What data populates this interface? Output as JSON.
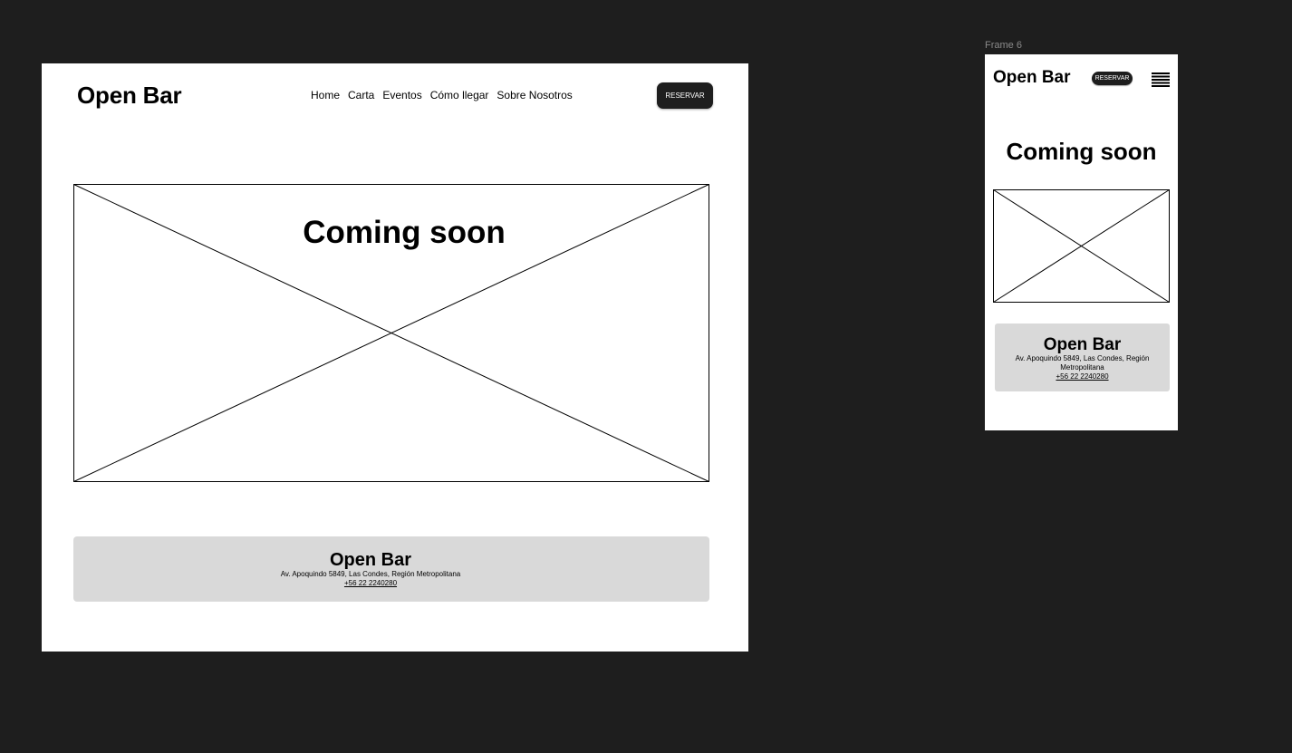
{
  "desktop": {
    "logo": "Open Bar",
    "nav": [
      "Home",
      "Carta",
      "Eventos",
      "Cómo llegar",
      "Sobre Nosotros"
    ],
    "reserve_label": "RESERVAR",
    "hero_title": "Coming soon",
    "footer": {
      "title": "Open Bar",
      "address": "Av. Apoquindo 5849, Las Condes, Región Metropolitana",
      "phone": "+56 22 2240280"
    }
  },
  "mobile": {
    "frame_label": "Frame 6",
    "logo": "Open Bar",
    "reserve_label": "RESERVAR",
    "menu_icon": "hamburger-menu-icon",
    "hero_title": "Coming soon",
    "footer": {
      "title": "Open Bar",
      "address": "Av. Apoquindo 5849, Las Condes, Región Metropolitana",
      "phone": "+56 22 2240280"
    }
  },
  "colors": {
    "canvas": "#1e1e1e",
    "frame": "#ffffff",
    "button": "#1e1e1e",
    "footer_bg": "#d9d9d9",
    "label": "#8a8a8a"
  }
}
